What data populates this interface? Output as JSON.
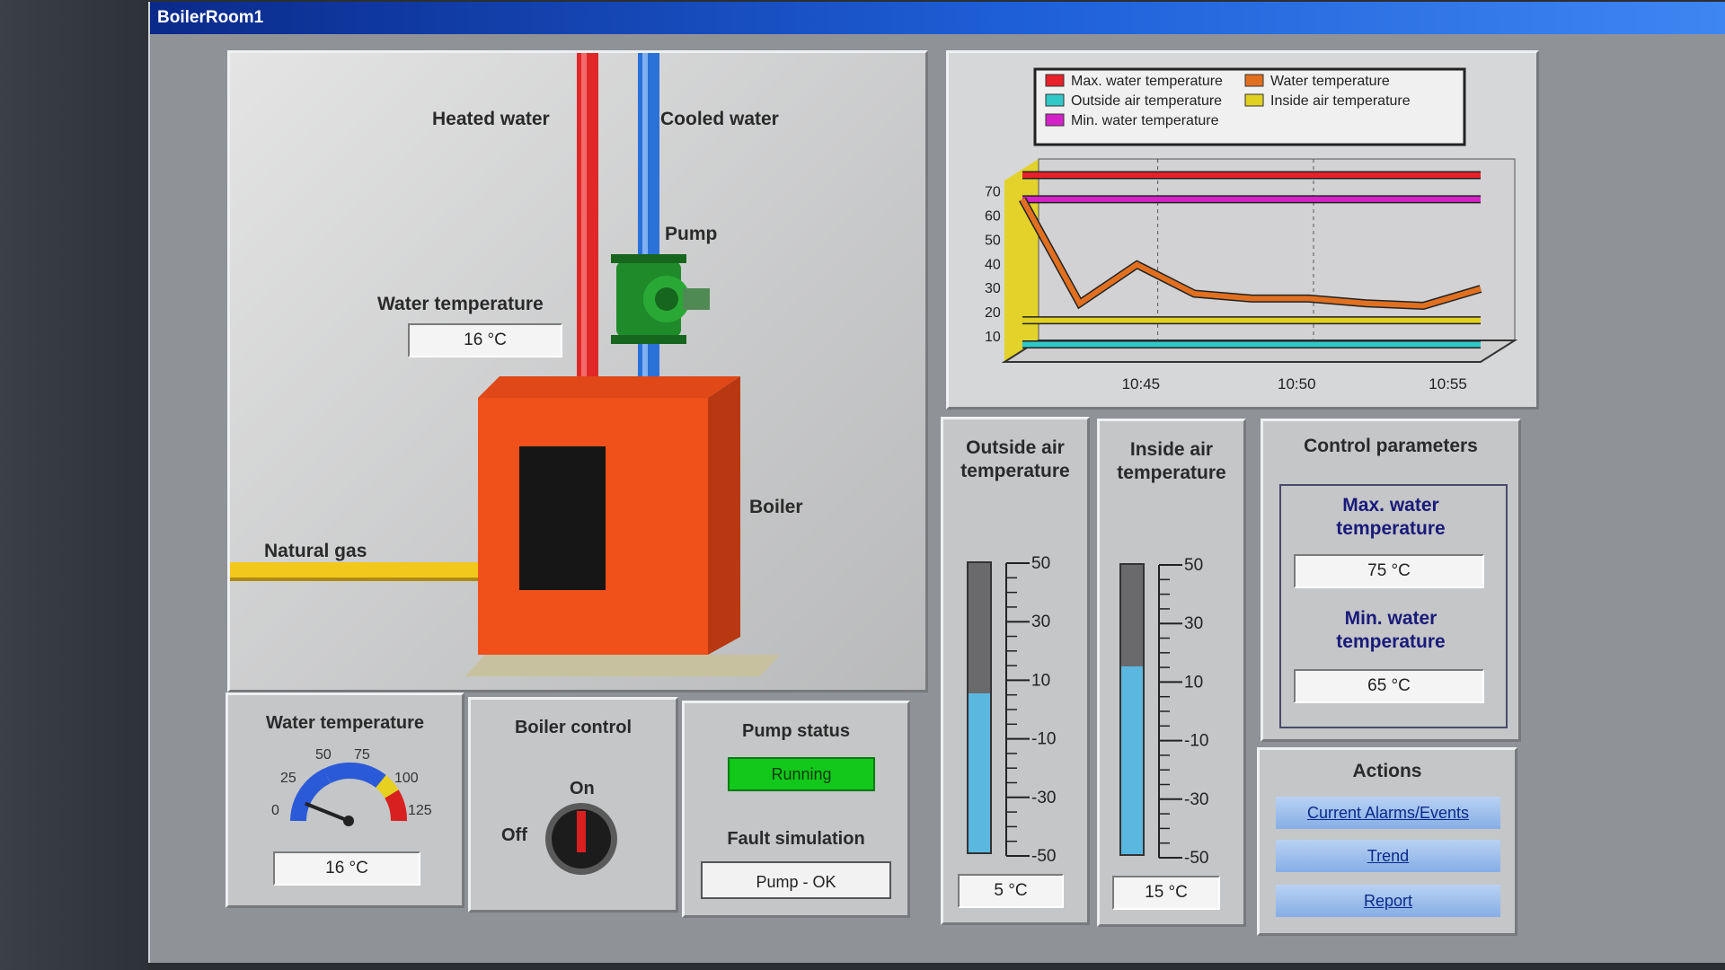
{
  "window": {
    "title": "BoilerRoom1"
  },
  "process": {
    "heated_water_label": "Heated water",
    "cooled_water_label": "Cooled water",
    "pump_label": "Pump",
    "water_temp_label": "Water temperature",
    "water_temp_value": "16 °C",
    "boiler_label": "Boiler",
    "natural_gas_label": "Natural gas"
  },
  "gauge_panel": {
    "title": "Water temperature",
    "scale": [
      "0",
      "25",
      "50",
      "75",
      "100",
      "125"
    ],
    "value": "16 °C",
    "reading": 16
  },
  "boiler_control": {
    "title": "Boiler control",
    "on_label": "On",
    "off_label": "Off"
  },
  "pump_panel": {
    "title": "Pump status",
    "status": "Running",
    "fault_title": "Fault simulation",
    "fault_button": "Pump - OK"
  },
  "chart_data": {
    "type": "line",
    "legend": [
      "Max. water temperature",
      "Water temperature",
      "Outside air temperature",
      "Inside air temperature",
      "Min. water temperature"
    ],
    "y_ticks": [
      "70",
      "60",
      "50",
      "40",
      "30",
      "20",
      "10"
    ],
    "x_ticks": [
      "10:45",
      "10:50",
      "10:55"
    ],
    "ylim": [
      0,
      75
    ],
    "series": [
      {
        "name": "Max. water temperature",
        "color": "#e8202a",
        "values": [
          75,
          75,
          75,
          75
        ]
      },
      {
        "name": "Min. water temperature",
        "color": "#d422c8",
        "values": [
          65,
          65,
          65,
          65
        ]
      },
      {
        "name": "Water temperature",
        "color": "#e07020",
        "values": [
          65,
          22,
          38,
          26,
          24,
          24,
          22,
          21,
          28
        ]
      },
      {
        "name": "Inside air temperature",
        "color": "#e0d020",
        "values": [
          15,
          15,
          15,
          15
        ]
      },
      {
        "name": "Outside air temperature",
        "color": "#30c8c8",
        "values": [
          5,
          5,
          5,
          5
        ]
      }
    ]
  },
  "outside_air": {
    "title_line1": "Outside air",
    "title_line2": "temperature",
    "ticks": [
      "50",
      "30",
      "10",
      "-10",
      "-30",
      "-50"
    ],
    "value": "5 °C",
    "level": 5
  },
  "inside_air": {
    "title_line1": "Inside air",
    "title_line2": "temperature",
    "ticks": [
      "50",
      "30",
      "10",
      "-10",
      "-30",
      "-50"
    ],
    "value": "15 °C",
    "level": 15
  },
  "control": {
    "title": "Control parameters",
    "max_label_1": "Max. water",
    "max_label_2": "temperature",
    "max_value": "75 °C",
    "min_label_1": "Min. water",
    "min_label_2": "temperature",
    "min_value": "65 °C"
  },
  "actions": {
    "title": "Actions",
    "alarms": "Current Alarms/Events",
    "trend": "Trend",
    "report": "Report"
  },
  "colors": {
    "heated_pipe": "#e02828",
    "cooled_pipe": "#2a72d8",
    "gas_pipe": "#f2c81c",
    "boiler": "#f0501a",
    "pump": "#1f8a2a",
    "running": "#12c81a"
  }
}
